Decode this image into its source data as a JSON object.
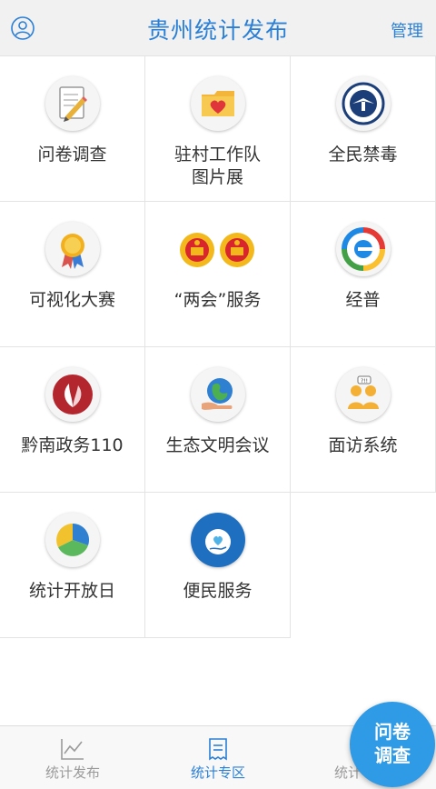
{
  "header": {
    "title": "贵州统计发布",
    "manage_label": "管理",
    "user_icon": "user-icon"
  },
  "grid": [
    {
      "label": "问卷调查",
      "icon": "survey-pencil-icon"
    },
    {
      "label": "驻村工作队\n图片展",
      "icon": "folder-heart-icon"
    },
    {
      "label": "全民禁毒",
      "icon": "anti-drug-badge-icon"
    },
    {
      "label": "可视化大赛",
      "icon": "award-medal-icon"
    },
    {
      "label": "“两会”服务",
      "icon": "national-emblems-icon"
    },
    {
      "label": "经普",
      "icon": "census-2018-logo-icon"
    },
    {
      "label": "黔南政务110",
      "icon": "leaf-emblem-icon"
    },
    {
      "label": "生态文明会议",
      "icon": "earth-hand-icon"
    },
    {
      "label": "面访系统",
      "icon": "interview-people-icon"
    },
    {
      "label": "统计开放日",
      "icon": "pie-chart-icon"
    },
    {
      "label": "便民服务",
      "icon": "public-service-heart-icon"
    }
  ],
  "tabbar": [
    {
      "label": "统计发布",
      "icon": "line-chart-icon",
      "active": false
    },
    {
      "label": "统计专区",
      "icon": "receipt-icon",
      "active": true
    },
    {
      "label": "统计",
      "icon": "tab-icon",
      "active": false
    }
  ],
  "fab": {
    "line1": "问卷",
    "line2": "调查"
  },
  "colors": {
    "accent": "#2a7fd6",
    "fab": "#2f9ae6",
    "header_bg": "#f1f1f1"
  }
}
